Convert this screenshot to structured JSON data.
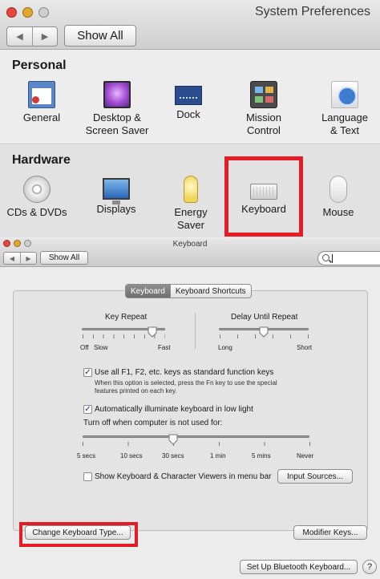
{
  "sysprefs": {
    "title": "System Preferences",
    "show_all": "Show All",
    "nav_back": "◀",
    "nav_forward": "▶",
    "personal": {
      "label": "Personal",
      "items": [
        {
          "icon": "general-icon",
          "label": "General"
        },
        {
          "icon": "desktop-screen-saver-icon",
          "label1": "Desktop &",
          "label2": "Screen Saver"
        },
        {
          "icon": "dock-icon",
          "label": "Dock"
        },
        {
          "icon": "mission-control-icon",
          "label1": "Mission",
          "label2": "Control"
        },
        {
          "icon": "language-text-icon",
          "label1": "Language",
          "label2": "& Text"
        }
      ]
    },
    "hardware": {
      "label": "Hardware",
      "items": [
        {
          "icon": "cds-dvds-icon",
          "label": "CDs & DVDs"
        },
        {
          "icon": "displays-icon",
          "label": "Displays"
        },
        {
          "icon": "energy-saver-icon",
          "label1": "Energy",
          "label2": "Saver"
        },
        {
          "icon": "keyboard-icon",
          "label": "Keyboard"
        },
        {
          "icon": "mouse-icon",
          "label": "Mouse"
        }
      ]
    }
  },
  "keyboard": {
    "title": "Keyboard",
    "show_all": "Show All",
    "nav_back": "◀",
    "nav_forward": "▶",
    "search": {
      "value": ""
    },
    "tabs": [
      {
        "label": "Keyboard",
        "active": true
      },
      {
        "label": "Keyboard Shortcuts",
        "active": false
      }
    ],
    "key_repeat": {
      "label": "Key Repeat",
      "min1": "Off",
      "min2": "Slow",
      "max": "Fast",
      "level": 0.85
    },
    "delay_until_repeat": {
      "label": "Delay Until Repeat",
      "min": "Long",
      "max": "Short",
      "level": 0.5
    },
    "fn_keys": {
      "checked": true,
      "label": "Use all F1, F2, etc. keys as standard function keys",
      "description1": "When this option is selected, press the Fn key to use the special",
      "description2": "features printed on each key."
    },
    "illuminate": {
      "checked": true,
      "label": "Automatically illuminate keyboard in low light"
    },
    "turn_off": {
      "label": "Turn off when computer is not used for:",
      "ticks": [
        "5 secs",
        "10 secs",
        "30 secs",
        "1 min",
        "5 mins",
        "Never"
      ],
      "selected": "30 secs"
    },
    "viewers": {
      "checked": false,
      "label": "Show Keyboard & Character Viewers in menu bar"
    },
    "input_sources": "Input Sources...",
    "change_type": "Change Keyboard Type...",
    "modifier_keys": "Modifier Keys...",
    "bluetooth": "Set Up Bluetooth Keyboard...",
    "help": "?",
    "check_mark": "✓"
  },
  "colors": {
    "highlight": "#e41d25",
    "tab_active": "#7a7a7a"
  }
}
